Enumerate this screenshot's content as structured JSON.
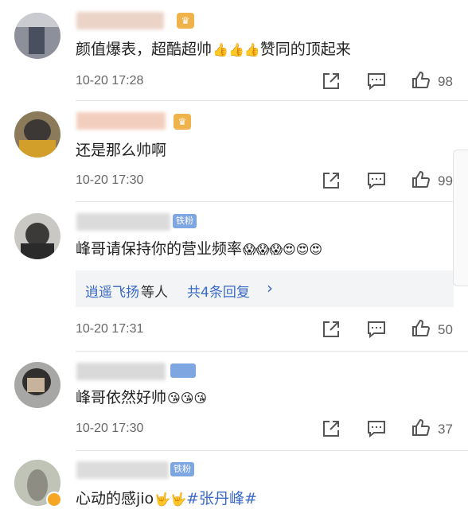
{
  "comments": [
    {
      "text": "颜值爆表，超酷超帅",
      "emoji": "👍👍👍",
      "text2": "赞同的顶起来",
      "time": "10-20 17:28",
      "likes": "98"
    },
    {
      "text": "还是那么帅啊",
      "time": "10-20 17:30",
      "likes": "99"
    },
    {
      "text": "峰哥请保持你的营业频率",
      "emoji": "😱😱😱😍😍😍",
      "badge": "铁粉",
      "replies_user": "逍遥飞扬",
      "replies_mid": "等人",
      "replies_count": "共4条回复",
      "replies_chevron": "›",
      "time": "10-20 17:31",
      "likes": "50"
    },
    {
      "text": "峰哥依然好帅",
      "emoji": "😘😘😘",
      "time": "10-20 17:30",
      "likes": "37"
    },
    {
      "text": "心动的感jio",
      "emoji": "🤟🤟",
      "tag": "#张丹峰#",
      "badge": "铁粉"
    }
  ],
  "icons": {
    "share": "share-icon",
    "comment": "comment-icon",
    "like": "thumbs-up-icon"
  },
  "colors": {
    "link": "#3a6ac8",
    "badge": "#7ea6e0",
    "muted": "#666666"
  }
}
